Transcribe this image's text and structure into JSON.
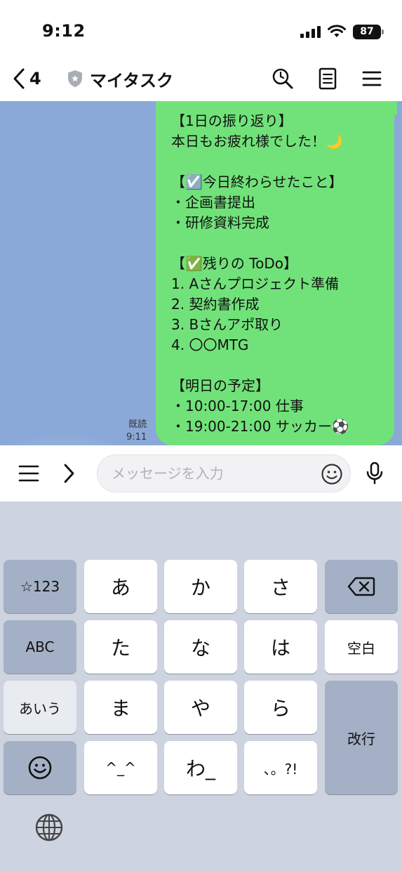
{
  "status_bar": {
    "time": "9:12",
    "battery": "87"
  },
  "header": {
    "back_count": "4",
    "title": "マイタスク"
  },
  "chat": {
    "message_lines": [
      "【1日の振り返り】",
      "本日もお疲れ様でした！🌙",
      "",
      "【☑️今日終わらせたこと】",
      "・企画書提出",
      "・研修資料完成",
      "",
      "【✅残りの ToDo】",
      "1. Aさんプロジェクト準備",
      "2. 契約書作成",
      "3. Bさんアポ取り",
      "4. 〇〇MTG",
      "",
      "【明日の予定】",
      "・10:00-17:00 仕事",
      "・19:00-21:00 サッカー⚽"
    ],
    "read_label": "既読",
    "sent_time": "9:11"
  },
  "input": {
    "placeholder": "メッセージを入力"
  },
  "keyboard": {
    "symbols_key": "☆123",
    "abc_key": "ABC",
    "kana_mode_key": "あいう",
    "row1": [
      "あ",
      "か",
      "さ"
    ],
    "row2": [
      "た",
      "な",
      "は"
    ],
    "row3": [
      "ま",
      "や",
      "ら"
    ],
    "row4": [
      "^_^",
      "わ_",
      "、。?!"
    ],
    "space_key": "空白",
    "return_key": "改行"
  }
}
